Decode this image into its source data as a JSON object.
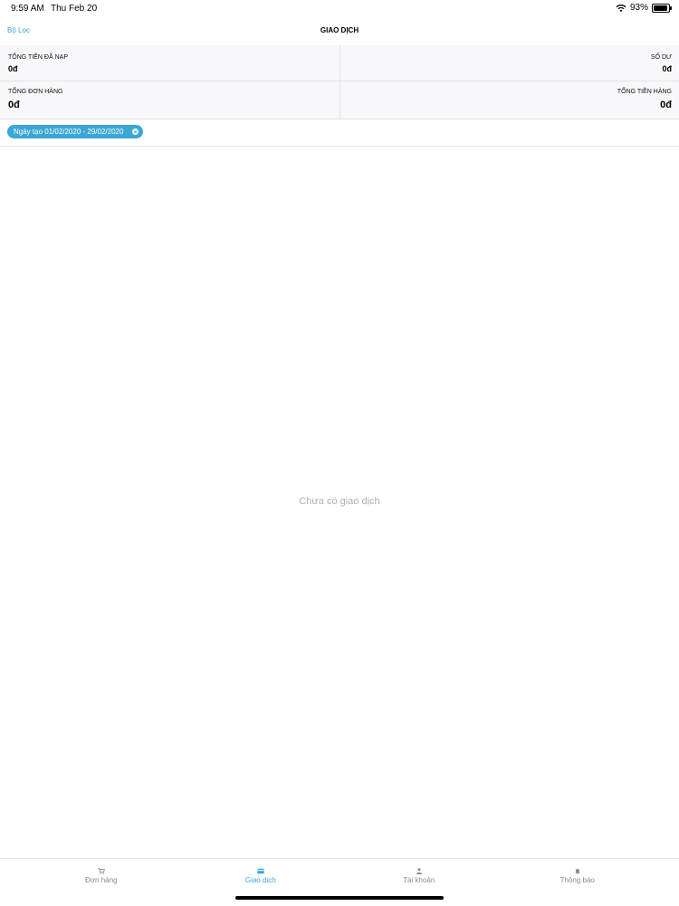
{
  "status_bar": {
    "time": "9:59 AM",
    "date": "Thu Feb 20",
    "battery": "93%",
    "battery_level": 0.93
  },
  "nav": {
    "filter_label": "Bộ Lọc",
    "title": "GIAO DỊCH"
  },
  "summary": {
    "topup_label": "TỔNG TIỀN ĐÃ NẠP",
    "topup_value": "0đ",
    "balance_label": "SỐ DƯ",
    "balance_value": "0đ",
    "orders_label": "TỔNG ĐƠN HÀNG",
    "orders_value": "0đ",
    "total_label": "TỔNG TIỀN HÀNG",
    "total_value": "0đ"
  },
  "filter_chip": {
    "label": "Ngày tạo 01/02/2020 - 29/02/2020"
  },
  "empty_message": "Chưa có giao dịch",
  "tabs": [
    {
      "label": "Đơn hàng",
      "icon": "cart-icon",
      "active": false
    },
    {
      "label": "Giao dịch",
      "icon": "card-icon",
      "active": true
    },
    {
      "label": "Tài khoản",
      "icon": "person-icon",
      "active": false
    },
    {
      "label": "Thông báo",
      "icon": "bell-icon",
      "active": false
    }
  ],
  "colors": {
    "accent": "#3aa7d6",
    "inactive": "#8c8c90",
    "summary_bg": "#f8f8fa"
  }
}
